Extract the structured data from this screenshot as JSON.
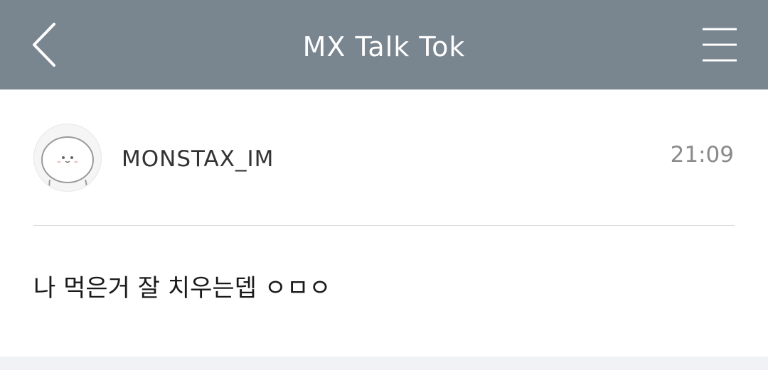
{
  "header": {
    "title": "MX Talk Tok",
    "back_icon": "chevron-left-icon",
    "menu_icon": "hamburger-menu-icon"
  },
  "post": {
    "username": "MONSTAX_IM",
    "time": "21:09",
    "message": "나 먹은거 잘 치우는뎁 ㅇㅁㅇ",
    "avatar_icon": "cartoon-avatar"
  },
  "colors": {
    "header_bg": "#79858f",
    "footer_bg": "#f0f2f5"
  }
}
